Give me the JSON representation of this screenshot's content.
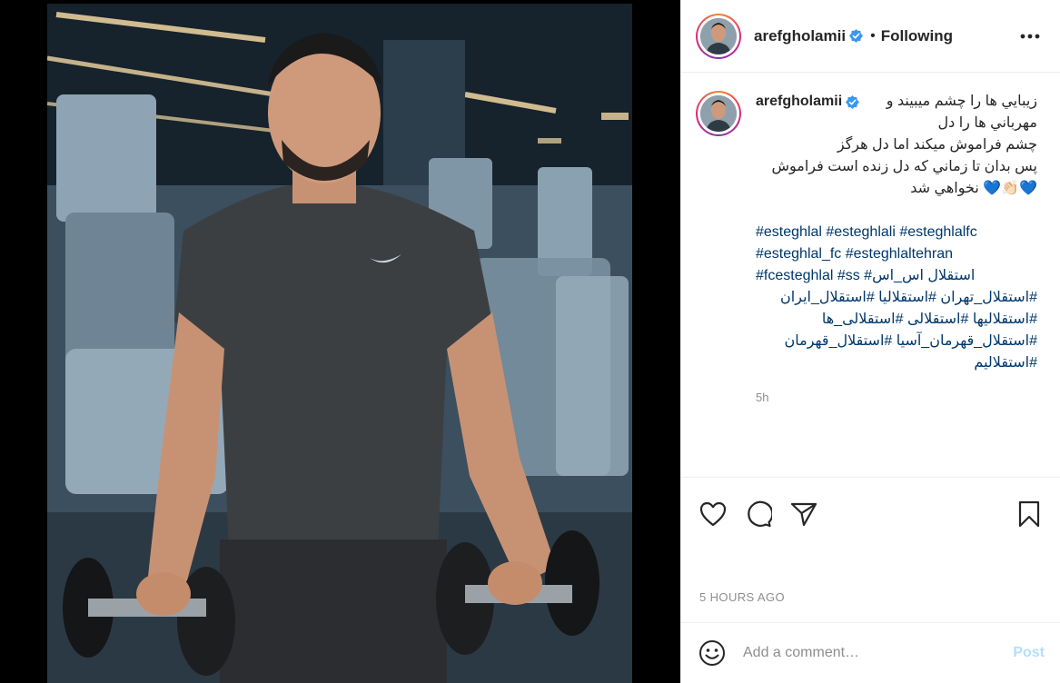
{
  "post": {
    "image_alt": "Photo of a man holding dumbbells in a gym"
  },
  "header": {
    "username": "arefgholamii",
    "separator": "•",
    "follow_status": "Following",
    "more_icon": "more-horizontal-icon"
  },
  "caption": {
    "username": "arefgholamii",
    "lines": [
      "زيبايي ها را چشم ميبيند و",
      "مهرباني ها را دل",
      "چشم فراموش ميكند اما دل هرگز",
      "پس بدان تا زماني كه دل زنده است فراموش",
      "💙👏🏻💙 نخواهي شد"
    ],
    "hashtags": [
      "#esteghlal #esteghlali #esteghlalfc",
      "#esteghlal_fc #esteghlaltehran",
      "#fcesteghlal #ss #استقلال اس_اس",
      "#استقلال_تهران #استقلاليا #استقلال_ايران",
      "#استقلاليها #استقلالی #استقلالی_ها",
      "#استقلال_قهرمان_آسيا #استقلال_قهرمان",
      "#استقلاليم"
    ],
    "time_ago": "5h"
  },
  "actions": {
    "like_icon": "heart-icon",
    "comment_icon": "comment-icon",
    "share_icon": "send-icon",
    "save_icon": "bookmark-icon",
    "date": "5 HOURS AGO"
  },
  "comment": {
    "emoji_icon": "smiley-icon",
    "placeholder": "Add a comment…",
    "post_label": "Post"
  },
  "colors": {
    "verified": "#3897f0",
    "link": "#00376b",
    "muted": "#8e8e8e",
    "post_disabled": "#b2dffc"
  }
}
